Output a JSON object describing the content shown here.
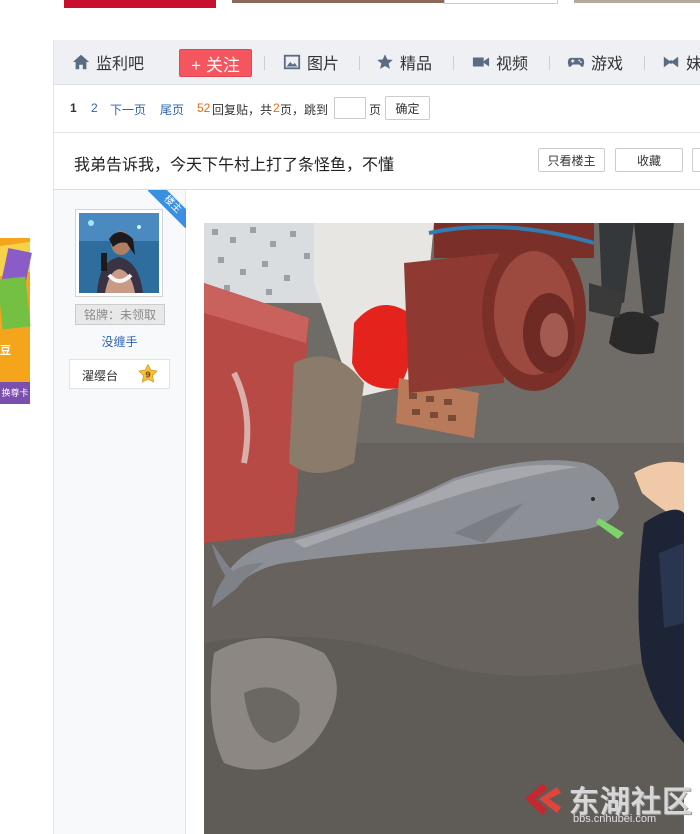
{
  "nav": {
    "forum_name": "监利吧",
    "follow_label": "+ 关注",
    "items": [
      {
        "label": "图片",
        "icon": "image-icon"
      },
      {
        "label": "精品",
        "icon": "star-icon"
      },
      {
        "label": "视频",
        "icon": "video-icon"
      },
      {
        "label": "游戏",
        "icon": "gamepad-icon"
      },
      {
        "label": "妹",
        "icon": "bow-icon"
      }
    ]
  },
  "pager": {
    "current": "1",
    "page2": "2",
    "next": "下一页",
    "last": "尾页",
    "reply_count": "52",
    "reply_text": "回复贴，共",
    "total_pages": "2",
    "pages_jump": "页，跳到",
    "page_unit": "页",
    "confirm": "确定"
  },
  "post": {
    "title": "我弟告诉我，今天下午村上打了条怪鱼，不懂",
    "only_author": "只看楼主",
    "favorite": "收藏",
    "louzhu": "楼主"
  },
  "author": {
    "badge": "铭牌：未领取",
    "name": "没缠手",
    "level_name": "濯缨台",
    "level": "9"
  },
  "side_ad": {
    "text": "豆",
    "footer": "换尊卡"
  },
  "watermark": {
    "brand": "东湖社区",
    "url": "bbs.cnhubei.com"
  },
  "colors": {
    "accent": "#f5555e",
    "link": "#2d64b3",
    "reply_count": "#e86b10",
    "louzhu_ribbon": "#3b8fe0"
  }
}
